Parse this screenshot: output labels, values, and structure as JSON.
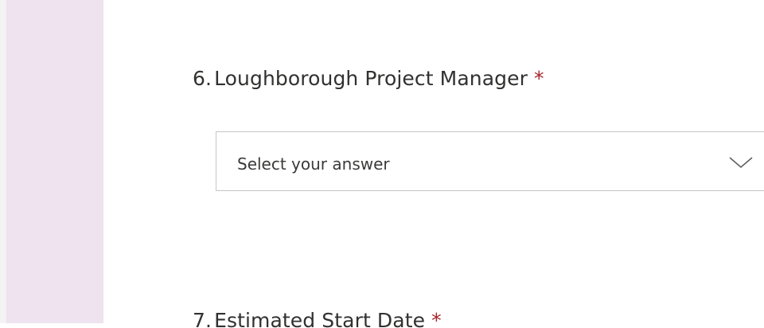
{
  "form": {
    "questions": [
      {
        "number": "6.",
        "title": "Loughborough Project Manager",
        "required_mark": "*",
        "dropdown": {
          "placeholder": "Select your answer",
          "icon": "chevron-down-icon"
        }
      },
      {
        "number": "7.",
        "title": "Estimated Start Date",
        "required_mark": "*"
      }
    ]
  },
  "colors": {
    "side_panel": "#efe3ef",
    "text": "#323130",
    "required": "#a4262c",
    "border": "#c8c6c4",
    "chevron": "#605e5c"
  }
}
